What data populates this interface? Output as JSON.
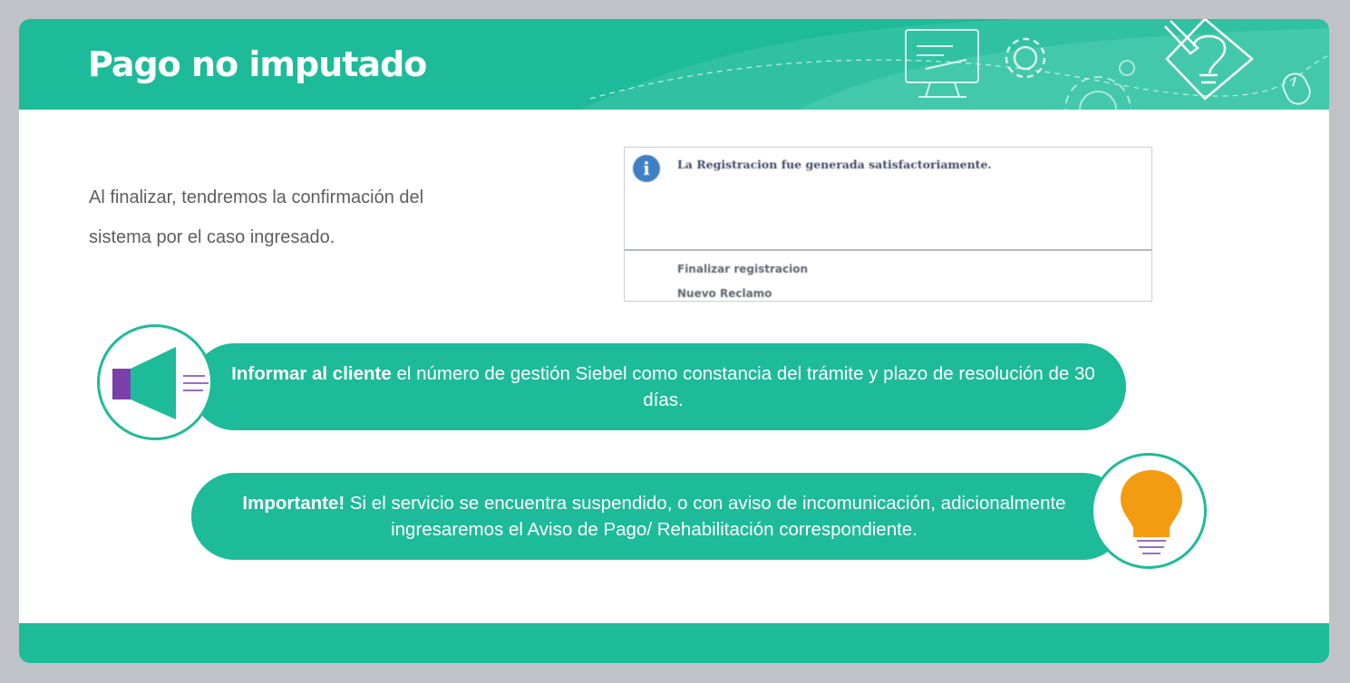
{
  "header": {
    "title": "Pago no imputado"
  },
  "intro": {
    "line1": "Al finalizar, tendremos la confirmación del",
    "line2": "sistema por el caso ingresado."
  },
  "screenshot": {
    "message": "La Registracion fue generada satisfactoriamente.",
    "links": [
      "Finalizar registracion",
      "Nuevo Reclamo"
    ],
    "icon": "info-icon"
  },
  "callouts": [
    {
      "bold": "Informar al cliente",
      "text": " el número de gestión Siebel como constancia del trámite y plazo de resolución de 30 días.",
      "icon": "megaphone-icon"
    },
    {
      "bold": "Importante!",
      "text": " Si el servicio se encuentra suspendido, o con aviso de incomunicación, adicionalmente ingresaremos el Aviso de Pago/ Rehabilitación correspondiente.",
      "icon": "lightbulb-icon"
    }
  ],
  "header_icons": [
    "monitor-icon",
    "gear-icon",
    "idea-pencil-icon",
    "mouse-icon"
  ],
  "colors": {
    "accent": "#1dbb99",
    "background": "#bfc3c7",
    "megaphone": "#1dbb99",
    "megaphone_handle": "#7b3fa8",
    "bulb": "#f39c12"
  }
}
